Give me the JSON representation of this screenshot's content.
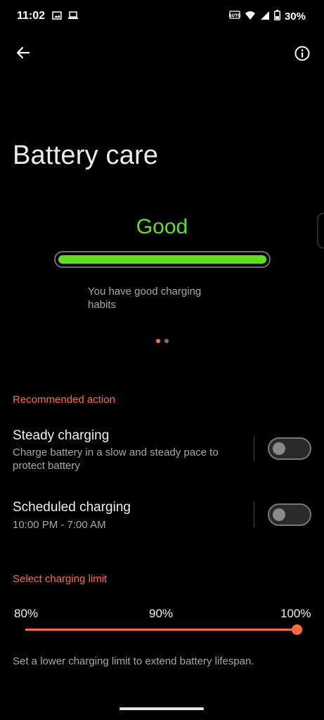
{
  "status_bar": {
    "time": "11:02",
    "battery_percent": "30%",
    "left_icons": [
      "gallery-icon",
      "laptop-icon"
    ],
    "right_icons": [
      "auto-badge-icon",
      "wifi-icon",
      "signal-icon",
      "battery-icon"
    ]
  },
  "toolbar": {
    "back_icon": "arrow-left-icon",
    "info_icon": "info-icon"
  },
  "page": {
    "title": "Battery care"
  },
  "battery_status": {
    "rating": "Good",
    "rating_color": "#5fe01f",
    "health_level": 1.0,
    "description": "You have good charging habits",
    "pager_total": 2,
    "pager_active": 1
  },
  "recommended": {
    "header": "Recommended action",
    "items": [
      {
        "title": "Steady charging",
        "subtitle": "Charge battery in a slow and steady pace to protect battery",
        "enabled": false
      },
      {
        "title": "Scheduled charging",
        "subtitle": "10:00 PM - 7:00 AM",
        "enabled": false
      }
    ]
  },
  "charging_limit": {
    "header": "Select charging limit",
    "options": [
      "80%",
      "90%",
      "100%"
    ],
    "selected": "100%",
    "note": "Set a lower charging limit to extend battery lifespan."
  },
  "colors": {
    "accent": "#ff6b3d",
    "good": "#5fe01f",
    "background": "#000000"
  }
}
